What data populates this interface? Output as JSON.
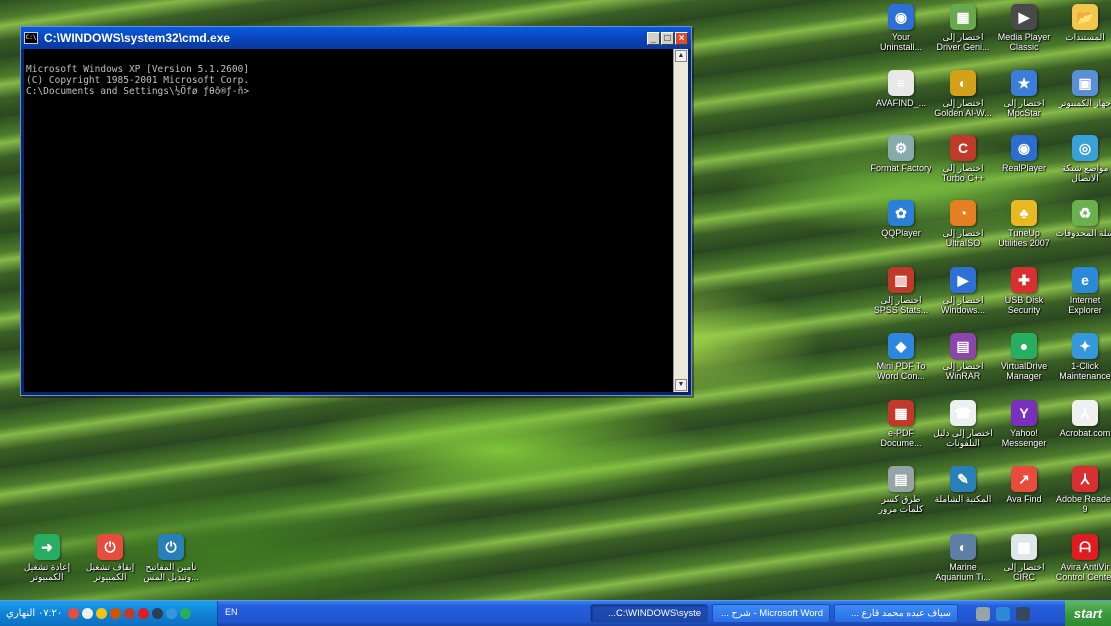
{
  "cmd": {
    "title": "C:\\WINDOWS\\system32\\cmd.exe",
    "icon_text": "C:\\",
    "lines": [
      "Microsoft Windows XP [Version 5.1.2600]",
      "(C) Copyright 1985-2001 Microsoft Corp.",
      "",
      "C:\\Documents and Settings\\½Õfø ƒθõ®ƒ-ñ>"
    ],
    "min": "_",
    "max": "□",
    "close": "×",
    "scroll_up": "▲",
    "scroll_down": "▼"
  },
  "icons": [
    {
      "label": "المستندات",
      "icon": "folder-icon",
      "color": "#f3c84a",
      "glyph": "📂"
    },
    {
      "label": "Media Player Classic",
      "icon": "media-player-icon",
      "color": "#4a4a4a",
      "glyph": "▶"
    },
    {
      "label": "اختصار إلى Driver Geni...",
      "icon": "driver-genius-icon",
      "color": "#6aa84f",
      "glyph": "▦"
    },
    {
      "label": "Your Uninstall...",
      "icon": "uninstaller-icon",
      "color": "#2c6fd6",
      "glyph": "◉"
    },
    {
      "label": "جهاز الكمبيوتر",
      "icon": "computer-icon",
      "color": "#5a8fd8",
      "glyph": "▣"
    },
    {
      "label": "اختصار إلى MpcStar",
      "icon": "mpcstar-icon",
      "color": "#3b7dd8",
      "glyph": "★"
    },
    {
      "label": "اختصار إلى Golden Al-W...",
      "icon": "golden-alwafi-icon",
      "color": "#d4a017",
      "glyph": "◐"
    },
    {
      "label": "AVAFIND_...",
      "icon": "document-icon",
      "color": "#e8e8e8",
      "glyph": "≡"
    },
    {
      "label": "مواضع شبكة الاتصال",
      "icon": "network-icon",
      "color": "#3aa0d8",
      "glyph": "◎"
    },
    {
      "label": "RealPlayer",
      "icon": "realplayer-icon",
      "color": "#2a6fd0",
      "glyph": "◉"
    },
    {
      "label": "اختصار إلى Turbo C++",
      "icon": "turbo-cpp-icon",
      "color": "#c0392b",
      "glyph": "C"
    },
    {
      "label": "Format Factory",
      "icon": "format-factory-icon",
      "color": "#8aa",
      "glyph": "⚙"
    },
    {
      "label": "سلة المحذوفات",
      "icon": "recycle-bin-icon",
      "color": "#6ab04c",
      "glyph": "♻"
    },
    {
      "label": "TuneUp Utilities 2007",
      "icon": "tuneup-icon",
      "color": "#e8b923",
      "glyph": "♣"
    },
    {
      "label": "اختصار إلى UltraISO",
      "icon": "ultraiso-icon",
      "color": "#e67e22",
      "glyph": "◔"
    },
    {
      "label": "QQPlayer",
      "icon": "qqplayer-icon",
      "color": "#2a7fd8",
      "glyph": "✿"
    },
    {
      "label": "Internet Explorer",
      "icon": "internet-explorer-icon",
      "color": "#2a8ad8",
      "glyph": "e"
    },
    {
      "label": "USB Disk Security",
      "icon": "usb-security-icon",
      "color": "#d63031",
      "glyph": "✚"
    },
    {
      "label": "اختصار إلى Windows...",
      "icon": "windows-media-icon",
      "color": "#2f6fd8",
      "glyph": "▶"
    },
    {
      "label": "اختصار إلى SPSS Stats...",
      "icon": "spss-icon",
      "color": "#c0392b",
      "glyph": "▥"
    },
    {
      "label": "1-Click Maintenance",
      "icon": "maintenance-icon",
      "color": "#3498db",
      "glyph": "✦"
    },
    {
      "label": "VirtualDrive Manager",
      "icon": "virtualdrive-icon",
      "color": "#27ae60",
      "glyph": "●"
    },
    {
      "label": "اختصار إلى WinRAR",
      "icon": "winrar-icon",
      "color": "#8e44ad",
      "glyph": "▤"
    },
    {
      "label": "Mini PDF To Word Con...",
      "icon": "pdf-to-word-icon",
      "color": "#2e86de",
      "glyph": "◆"
    },
    {
      "label": "Acrobat.com",
      "icon": "acrobat-com-icon",
      "color": "#f0f0f0",
      "glyph": "⅄"
    },
    {
      "label": "Yahoo! Messenger",
      "icon": "yahoo-messenger-icon",
      "color": "#7b2fbe",
      "glyph": "Y"
    },
    {
      "label": "اختصار إلى دليل التلفونات",
      "icon": "phone-directory-icon",
      "color": "#ecf0f1",
      "glyph": "☎"
    },
    {
      "label": "e-PDF Docume...",
      "icon": "epdf-icon",
      "color": "#c0392b",
      "glyph": "▦"
    },
    {
      "label": "Adobe Reader 9",
      "icon": "adobe-reader-icon",
      "color": "#d63031",
      "glyph": "⅄"
    },
    {
      "label": "Ava Find",
      "icon": "ava-find-icon",
      "color": "#e74c3c",
      "glyph": "↗"
    },
    {
      "label": "المكتبة الشاملة",
      "icon": "library-icon",
      "color": "#2980b9",
      "glyph": "✎"
    },
    {
      "label": "طرق كسر كلمات مرور",
      "icon": "document-icon",
      "color": "#95a5a6",
      "glyph": "▤"
    },
    {
      "label": "Avira AntiVir Control Center",
      "icon": "avira-icon",
      "color": "#e01b22",
      "glyph": "ᗩ"
    },
    {
      "label": "اختصار إلى CIRC",
      "icon": "circ-icon",
      "color": "#dfe6e9",
      "glyph": "▦"
    },
    {
      "label": "Marine Aquarium Ti...",
      "icon": "aquarium-icon",
      "color": "#5d7fa3",
      "glyph": "◐"
    },
    {
      "label": "إعادة تشغيل الكمبيوتر",
      "icon": "restart-icon",
      "color": "#27ae60",
      "glyph": "➜"
    },
    {
      "label": "إيقاف تشغيل الكمبيوتر",
      "icon": "shutdown-icon",
      "color": "#e74c3c",
      "glyph": "⏻"
    },
    {
      "label": "تأمين المفاتيح وتبديل المس...",
      "icon": "lock-switch-icon",
      "color": "#2980b9",
      "glyph": "⏻"
    }
  ],
  "taskbar": {
    "clock": "٠٧:٢٠ النهاري",
    "lang": "EN",
    "tasks": [
      {
        "label": "C:\\WINDOWS\\syste...",
        "icon": "cmd-icon"
      },
      {
        "label": "Microsoft Word - شرح ...",
        "icon": "word-icon"
      },
      {
        "label": "سياف عبده محمد قارع ...",
        "icon": "folder-icon"
      }
    ],
    "start": "start"
  }
}
